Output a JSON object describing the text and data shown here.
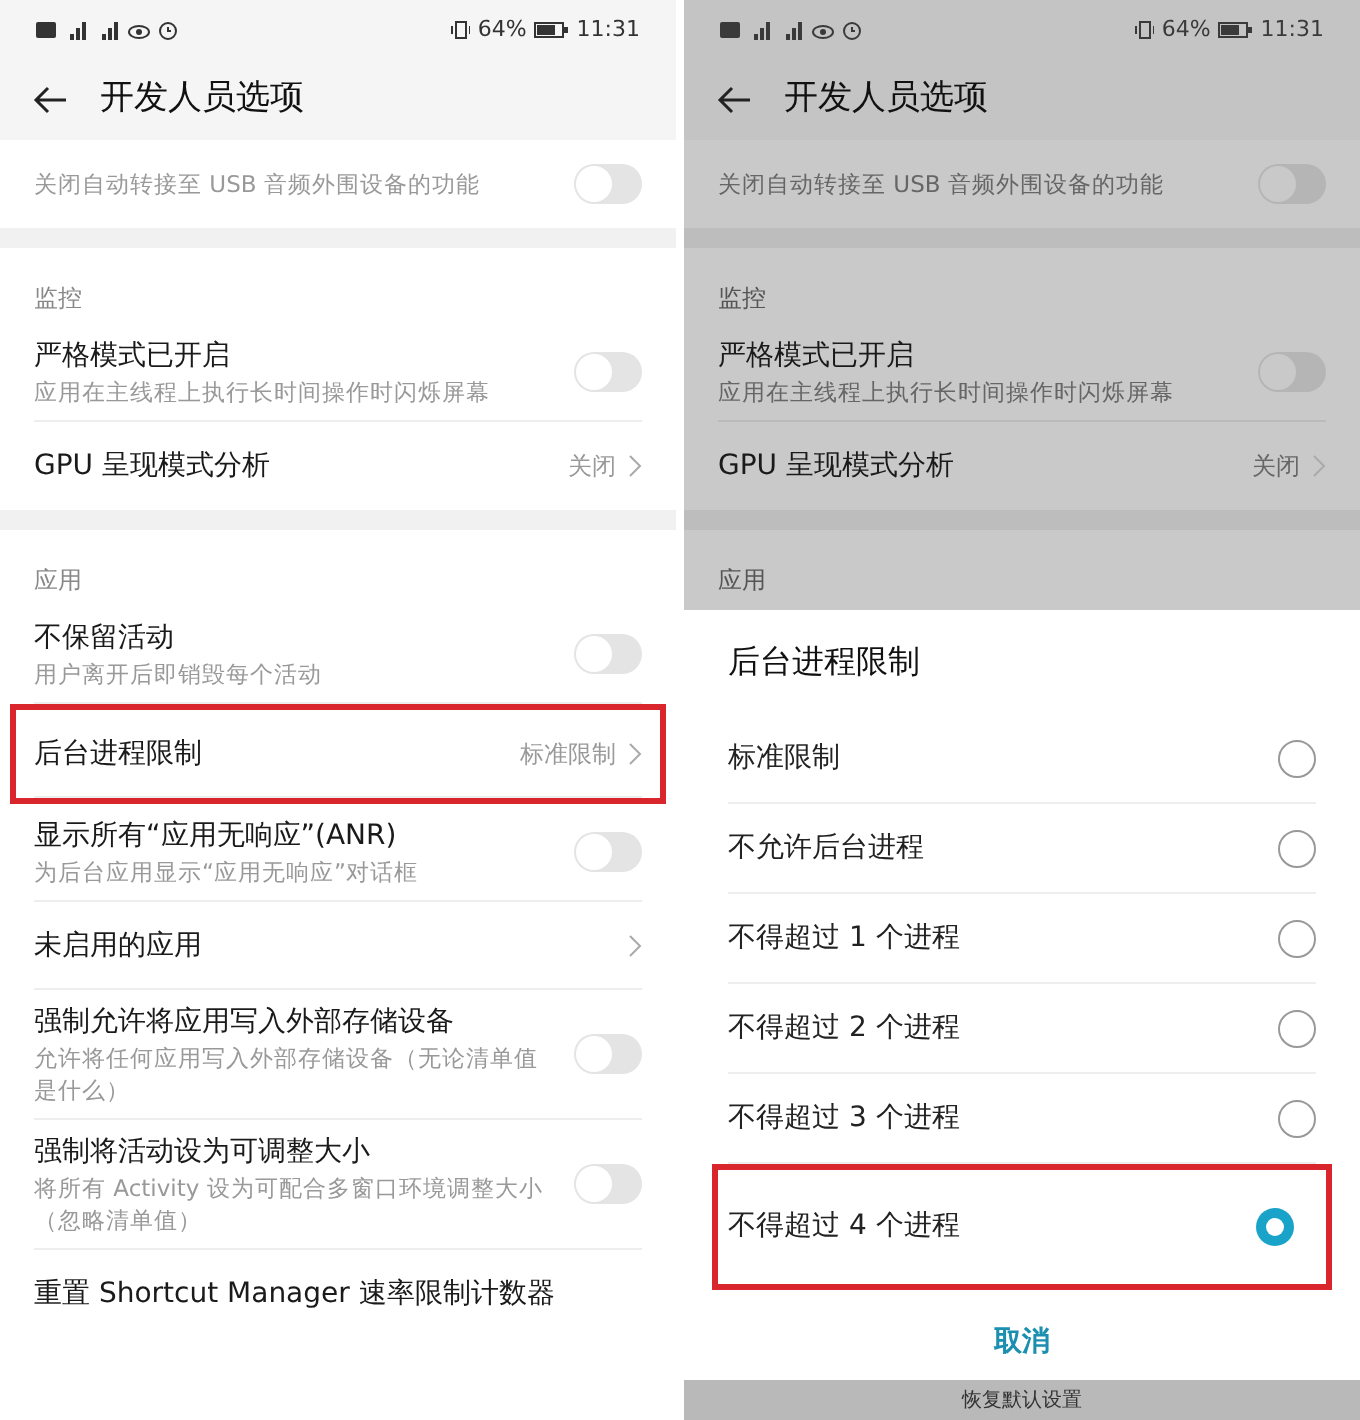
{
  "left_screen": {
    "status_bar": {
      "battery": "64%",
      "time": "11:31"
    },
    "title": "开发人员选项",
    "sections": [
      {
        "items": [
          {
            "kind": "toggle",
            "subtitle": "关闭自动转接至 USB 音频外围设备的功能",
            "on": false,
            "highlighted": false
          }
        ]
      },
      {
        "header": "监控",
        "items": [
          {
            "kind": "toggle",
            "title": "严格模式已开启",
            "subtitle": "应用在主线程上执行长时间操作时闪烁屏幕",
            "on": false,
            "highlighted": false
          },
          {
            "kind": "link",
            "title": "GPU 呈现模式分析",
            "value": "关闭",
            "highlighted": false
          }
        ]
      },
      {
        "header": "应用",
        "items": [
          {
            "kind": "toggle",
            "title": "不保留活动",
            "subtitle": "用户离开后即销毁每个活动",
            "on": false,
            "highlighted": false
          },
          {
            "kind": "link",
            "title": "后台进程限制",
            "value": "标准限制",
            "highlighted": true
          },
          {
            "kind": "toggle",
            "title": "显示所有“应用无响应”(ANR)",
            "subtitle": "为后台应用显示“应用无响应”对话框",
            "on": false,
            "highlighted": false
          },
          {
            "kind": "link",
            "title": "未启用的应用",
            "highlighted": false
          },
          {
            "kind": "toggle",
            "title": "强制允许将应用写入外部存储设备",
            "subtitle": "允许将任何应用写入外部存储设备（无论清单值是什么）",
            "on": false,
            "highlighted": false
          },
          {
            "kind": "toggle",
            "title": "强制将活动设为可调整大小",
            "subtitle": "将所有 Activity 设为可配合多窗口环境调整大小（忽略清单值）",
            "on": false,
            "highlighted": false
          },
          {
            "kind": "action",
            "title": "重置 Shortcut Manager 速率限制计数器",
            "highlighted": false
          }
        ]
      }
    ]
  },
  "right_screen": {
    "status_bar": {
      "battery": "64%",
      "time": "11:31"
    },
    "title": "开发人员选项",
    "sections": [
      {
        "items": [
          {
            "kind": "toggle",
            "subtitle": "关闭自动转接至 USB 音频外围设备的功能",
            "on": false,
            "highlighted": false
          }
        ]
      },
      {
        "header": "监控",
        "items": [
          {
            "kind": "toggle",
            "title": "严格模式已开启",
            "subtitle": "应用在主线程上执行长时间操作时闪烁屏幕",
            "on": false,
            "highlighted": false
          },
          {
            "kind": "link",
            "title": "GPU 呈现模式分析",
            "value": "关闭",
            "highlighted": false
          }
        ]
      },
      {
        "header": "应用"
      }
    ],
    "dialog": {
      "title": "后台进程限制",
      "options": [
        {
          "label": "标准限制",
          "selected": false,
          "highlighted": false
        },
        {
          "label": "不允许后台进程",
          "selected": false,
          "highlighted": false
        },
        {
          "label": "不得超过 1 个进程",
          "selected": false,
          "highlighted": false
        },
        {
          "label": "不得超过 2 个进程",
          "selected": false,
          "highlighted": false
        },
        {
          "label": "不得超过 3 个进程",
          "selected": false,
          "highlighted": false
        },
        {
          "label": "不得超过 4 个进程",
          "selected": true,
          "highlighted": true
        }
      ],
      "cancel": "取消"
    },
    "bottom_bar": "恢复默认设置"
  }
}
